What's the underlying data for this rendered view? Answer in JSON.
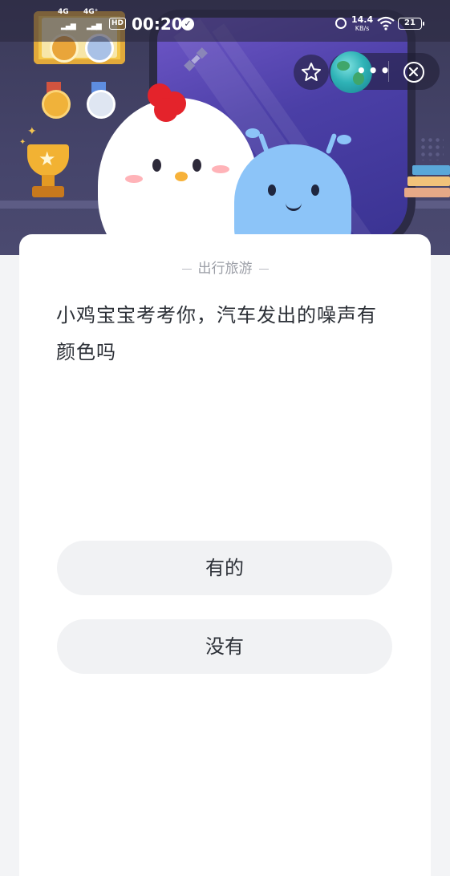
{
  "status_bar": {
    "network_1": "4G",
    "network_2": "4G⁺",
    "hd": "HD",
    "time": "00:20",
    "speed_value": "14.4",
    "speed_unit": "KB/s",
    "battery": "21"
  },
  "quiz": {
    "category": "出行旅游",
    "question": "小鸡宝宝考考你，汽车发出的噪声有颜色吗",
    "options": [
      {
        "label": "有的"
      },
      {
        "label": "没有"
      }
    ]
  },
  "colors": {
    "header_bg": "#3b3a58",
    "card_bg": "#ffffff",
    "option_bg": "#f1f2f4",
    "question_text": "#2b2f36",
    "category_text": "#9b9ea6"
  }
}
